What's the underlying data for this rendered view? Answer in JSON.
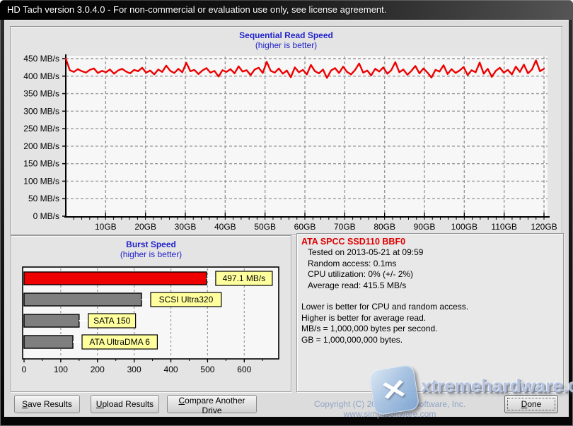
{
  "window": {
    "title": "HD Tach version 3.0.4.0  - For non-commercial or evaluation use only, see license agreement."
  },
  "chart_data": [
    {
      "type": "line",
      "title": "Sequential Read Speed",
      "subtitle": "(higher is better)",
      "ylabel_suffix": " MB/s",
      "y_ticks": [
        0,
        50,
        100,
        150,
        200,
        250,
        300,
        350,
        400,
        450
      ],
      "ylim": [
        0,
        450
      ],
      "x_ticks_gb": [
        10,
        20,
        30,
        40,
        50,
        60,
        70,
        80,
        90,
        100,
        110,
        120
      ],
      "x_tick_suffix": "GB",
      "xlim_gb": [
        0,
        120
      ],
      "grid": true,
      "line_color": "#ee0000",
      "values_mbs": [
        450,
        417,
        412,
        420,
        414,
        410,
        418,
        422,
        409,
        415,
        411,
        419,
        407,
        416,
        421,
        413,
        408,
        418,
        414,
        424,
        410,
        416,
        405,
        419,
        412,
        430,
        415,
        409,
        421,
        411,
        438,
        414,
        418,
        406,
        416,
        423,
        410,
        415,
        399,
        417,
        412,
        420,
        408,
        428,
        413,
        417,
        403,
        419,
        424,
        409,
        441,
        415,
        410,
        422,
        407,
        416,
        397,
        425,
        411,
        418,
        405,
        432,
        414,
        408,
        419,
        395,
        416,
        423,
        409,
        427,
        412,
        405,
        418,
        436,
        410,
        416,
        402,
        421,
        413,
        425,
        407,
        417,
        440,
        411,
        419,
        404,
        415,
        429,
        408,
        422,
        410,
        396,
        418,
        413,
        431,
        406,
        420,
        409,
        416,
        426,
        403,
        417,
        411,
        439,
        407,
        421,
        398,
        415,
        424,
        410,
        418,
        405,
        427,
        412,
        433,
        408,
        419,
        445,
        414,
        421
      ]
    },
    {
      "type": "bar",
      "orientation": "horizontal",
      "title": "Burst Speed",
      "subtitle": "(higher is better)",
      "bars": [
        {
          "label": "497.1 MB/s",
          "value": 497.1,
          "color": "#ee0000"
        },
        {
          "label": "SCSI Ultra320",
          "value": 320,
          "color": "#7f7f7f"
        },
        {
          "label": "SATA 150",
          "value": 150,
          "color": "#7f7f7f"
        },
        {
          "label": "ATA UltraDMA 6",
          "value": 133,
          "color": "#7f7f7f"
        }
      ],
      "x_ticks": [
        0,
        100,
        200,
        300,
        400,
        500,
        600
      ],
      "xlim": [
        0,
        690
      ],
      "grid": true,
      "label_bg": "#ffff9e"
    }
  ],
  "info": {
    "drive_name": "ATA SPCC SSD110 BBF0",
    "details": [
      "Tested on 2013-05-21 at 09:59",
      "Random access: 0.1ms",
      "CPU utilization: 0% (+/- 2%)",
      "Average read: 415.5 MB/s"
    ],
    "notes": [
      "Lower is better for CPU and random access.",
      "Higher is better for average read.",
      "MB/s = 1,000,000 bytes per second.",
      "GB = 1,000,000,000 bytes."
    ]
  },
  "buttons": {
    "save": {
      "key": "S",
      "rest": "ave Results"
    },
    "upload": {
      "key": "U",
      "rest": "pload Results"
    },
    "compare": {
      "key": "C",
      "rest": "ompare Another Drive"
    },
    "done": {
      "key": "D",
      "rest": "one"
    }
  },
  "footer": {
    "copyright": "Copyright (C) 2004 Simpli Software, Inc. www.simplisoftware.com"
  },
  "watermark": {
    "text": "xtremehardware.com",
    "logo_glyph": "✕"
  },
  "colors": {
    "title_blue": "#2222cc",
    "line_red": "#ee0000",
    "bar_gray": "#7f7f7f",
    "label_yellow": "#ffff9e",
    "drive_name_red": "#dd0000",
    "copyright_blue": "#90a4c6"
  }
}
